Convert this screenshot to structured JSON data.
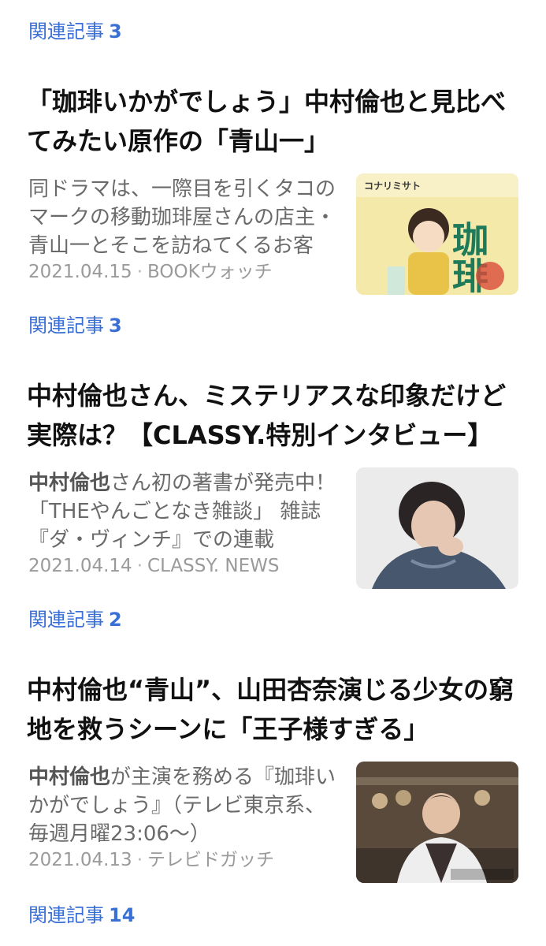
{
  "top_related": {
    "label": "関連記事",
    "count": "3"
  },
  "articles": [
    {
      "title": "「珈琲いかがでしょう」中村倫也と見比べてみたい原作の「青山一」",
      "snippet_highlight": "",
      "snippet": "同ドラマは、一際目を引くタコのマークの移動珈琲屋さんの店主・青山一とそこを訪ねてくるお客",
      "date": "2021.04.15",
      "source": "BOOKウォッチ",
      "related_label": "関連記事",
      "related_count": "3",
      "thumb_text": {
        "author": "コナリミサト",
        "book_title": "珈琲"
      }
    },
    {
      "title": "中村倫也さん、ミステリアスな印象だけど実際は？【CLASSY.特別インタビュー】",
      "snippet_highlight": "中村倫也",
      "snippet": "さん初の著書が発売中！「THEやんごとなき雑談」 雑誌『ダ・ヴィンチ』での連載",
      "date": "2021.04.14",
      "source": "CLASSY. NEWS",
      "related_label": "関連記事",
      "related_count": "2"
    },
    {
      "title": "中村倫也“青山”、山田杏奈演じる少女の窮地を救うシーンに「王子様すぎる」",
      "snippet_highlight": "中村倫也",
      "snippet": "が主演を務める『珈琲いかがでしょう』（テレビ東京系、毎週月曜23:06〜）",
      "date": "2021.04.13",
      "source": "テレビドガッチ",
      "related_label": "関連記事",
      "related_count": "14"
    }
  ],
  "colors": {
    "link": "#3a6fd6",
    "title": "#111111",
    "snippet": "#6a6a6a",
    "meta": "#9a9a9a"
  }
}
